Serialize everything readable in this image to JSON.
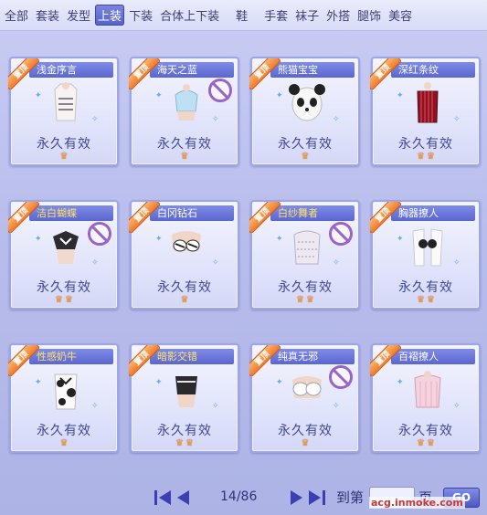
{
  "tabs": [
    {
      "label": "全部",
      "active": false
    },
    {
      "label": "套装",
      "active": false
    },
    {
      "label": "发型",
      "active": false
    },
    {
      "label": "上装",
      "active": true
    },
    {
      "label": "下装",
      "active": false
    },
    {
      "label": "合体上下装",
      "active": false
    },
    {
      "label": "鞋",
      "active": false
    },
    {
      "label": "手套",
      "active": false
    },
    {
      "label": "袜子",
      "active": false
    },
    {
      "label": "外搭",
      "active": false
    },
    {
      "label": "腿饰",
      "active": false
    },
    {
      "label": "美容",
      "active": false
    }
  ],
  "ribbon_label": "置顶",
  "items": [
    {
      "name": "浅金序言",
      "validity": "永久有效",
      "crowns": 1,
      "banned": false,
      "gold_name": false,
      "icon": "garment-white-strappy-top-icon"
    },
    {
      "name": "海天之蓝",
      "validity": "永久有效",
      "crowns": 1,
      "banned": true,
      "gold_name": false,
      "icon": "garment-light-blue-top-icon"
    },
    {
      "name": "熊猫宝宝",
      "validity": "永久有效",
      "crowns": 1,
      "banned": false,
      "gold_name": false,
      "icon": "garment-panda-top-icon"
    },
    {
      "name": "深红条纹",
      "validity": "永久有效",
      "crowns": 2,
      "banned": false,
      "gold_name": false,
      "icon": "garment-red-striped-corset-icon"
    },
    {
      "name": "洁白蝴蝶",
      "validity": "永久有效",
      "crowns": 2,
      "banned": true,
      "gold_name": true,
      "icon": "garment-white-butterfly-top-icon"
    },
    {
      "name": "白冈钻石",
      "validity": "永久有效",
      "crowns": 1,
      "banned": false,
      "gold_name": false,
      "icon": "garment-zebra-bikini-icon"
    },
    {
      "name": "白纱舞者",
      "validity": "永久有效",
      "crowns": 2,
      "banned": true,
      "gold_name": true,
      "icon": "garment-white-lace-dancer-icon"
    },
    {
      "name": "胸器撩人",
      "validity": "永久有效",
      "crowns": 2,
      "banned": false,
      "gold_name": false,
      "icon": "garment-open-white-shirt-icon"
    },
    {
      "name": "性感奶牛",
      "validity": "永久有效",
      "crowns": 1,
      "banned": false,
      "gold_name": true,
      "icon": "garment-cow-print-top-icon"
    },
    {
      "name": "暗影交错",
      "validity": "永久有效",
      "crowns": 2,
      "banned": false,
      "gold_name": true,
      "icon": "garment-black-halter-top-icon"
    },
    {
      "name": "纯真无邪",
      "validity": "永久有效",
      "crowns": 1,
      "banned": true,
      "gold_name": false,
      "icon": "garment-white-lace-bra-icon"
    },
    {
      "name": "百褶撩人",
      "validity": "永久有效",
      "crowns": 2,
      "banned": false,
      "gold_name": false,
      "icon": "garment-pink-pleated-top-icon"
    }
  ],
  "pager": {
    "page": "14/86",
    "goto_label": "到第",
    "unit": "页",
    "go_label": "GO",
    "watermark": "acg.inmoke.com"
  },
  "colors": {
    "accent": "#5661c6",
    "ribbon": "#f07a2a",
    "crown": "#f0a51c",
    "ban": "#9a63c9"
  }
}
